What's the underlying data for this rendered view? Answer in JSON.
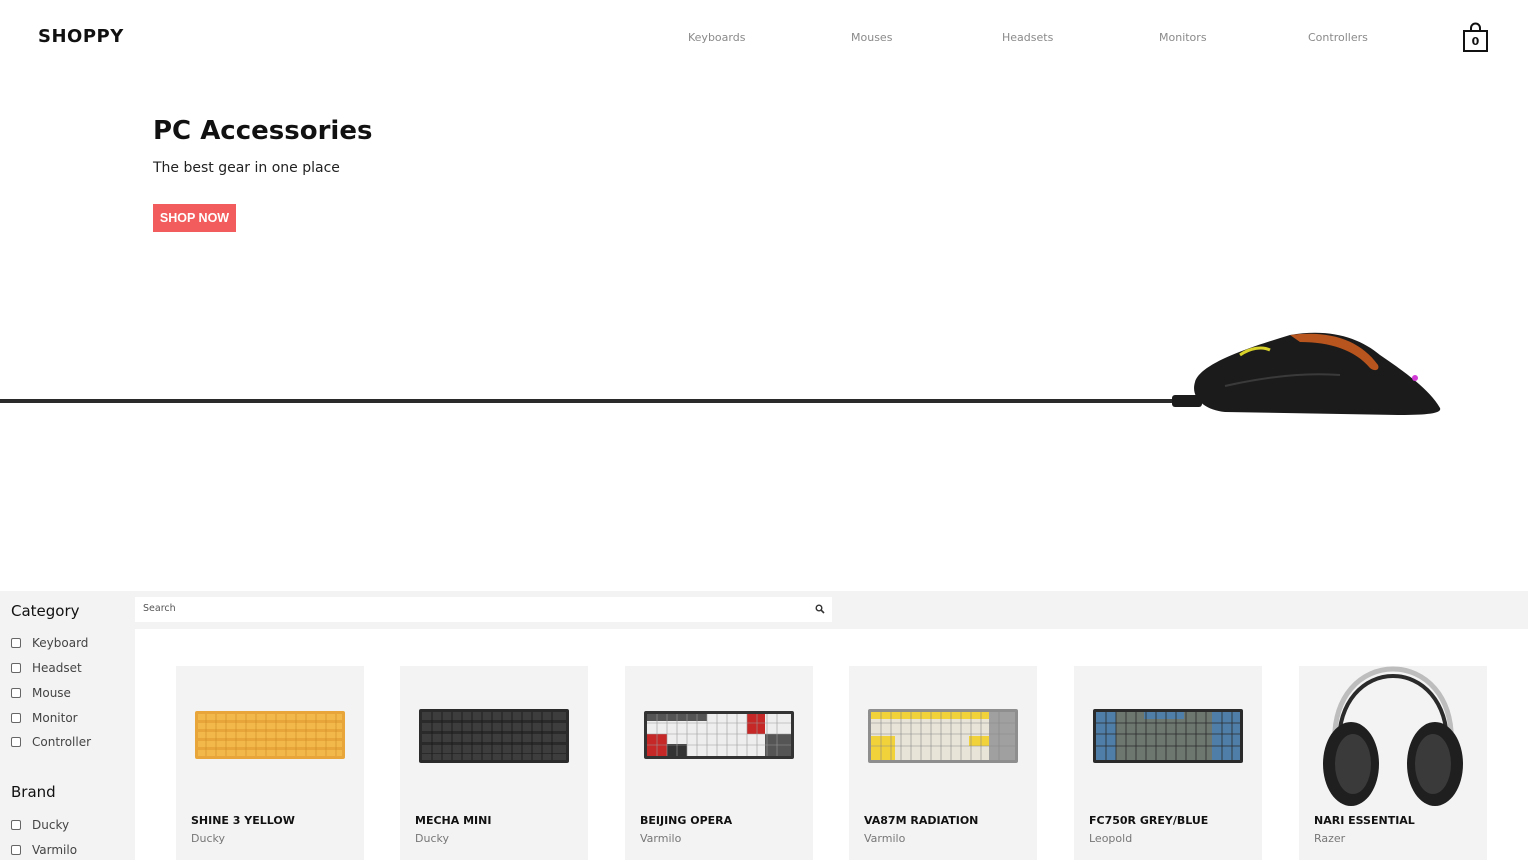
{
  "brand": "SHOPPY",
  "nav": [
    "Keyboards",
    "Mouses",
    "Headsets",
    "Monitors",
    "Controllers"
  ],
  "cart": {
    "icon": "bag-icon",
    "count": "0"
  },
  "hero": {
    "title": "PC Accessories",
    "subtitle": "The best gear in one place",
    "cta": "SHOP NOW",
    "accent": "#f25c5c"
  },
  "filters": {
    "category_title": "Category",
    "categories": [
      "Keyboard",
      "Headset",
      "Mouse",
      "Monitor",
      "Controller"
    ],
    "brand_title": "Brand",
    "brands": [
      "Ducky",
      "Varmilo"
    ]
  },
  "search": {
    "placeholder": "Search",
    "icon": "search-icon"
  },
  "products": [
    {
      "name": "SHINE 3 YELLOW",
      "brand": "Ducky"
    },
    {
      "name": "MECHA MINI",
      "brand": "Ducky"
    },
    {
      "name": "BEIJING OPERA",
      "brand": "Varmilo"
    },
    {
      "name": "VA87M RADIATION",
      "brand": "Varmilo"
    },
    {
      "name": "FC750R GREY/BLUE",
      "brand": "Leopold"
    },
    {
      "name": "NARI ESSENTIAL",
      "brand": "Razer"
    }
  ]
}
